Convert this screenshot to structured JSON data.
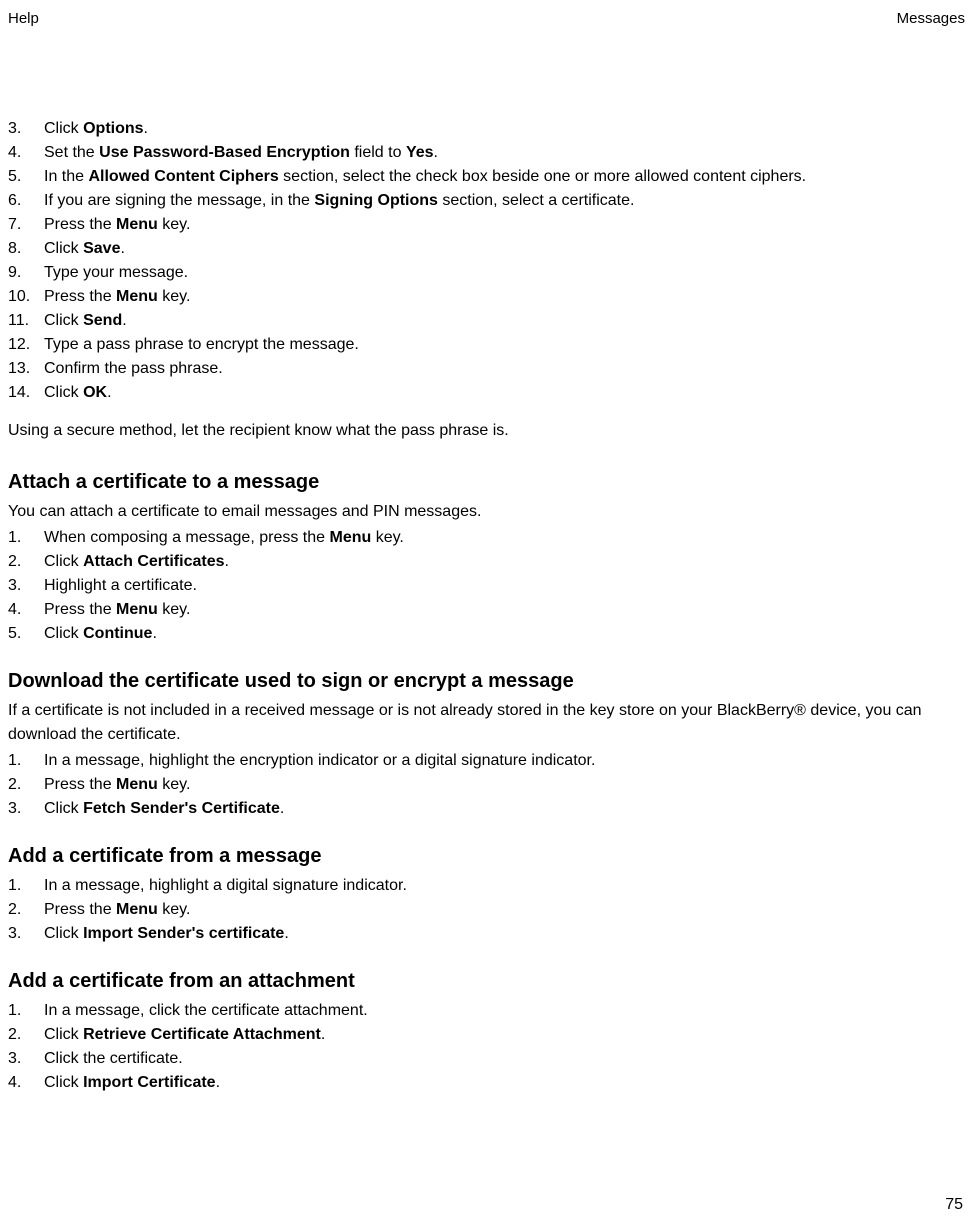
{
  "header": {
    "left": "Help",
    "right": "Messages"
  },
  "section1": {
    "steps": [
      {
        "num": "3.",
        "parts": [
          "Click ",
          "Options",
          "."
        ]
      },
      {
        "num": "4.",
        "parts": [
          "Set the ",
          "Use Password-Based Encryption",
          " field to ",
          "Yes",
          "."
        ]
      },
      {
        "num": "5.",
        "parts": [
          "In the ",
          "Allowed Content Ciphers",
          " section, select the check box beside one or more allowed content ciphers."
        ]
      },
      {
        "num": "6.",
        "parts": [
          "If you are signing the message, in the ",
          "Signing Options",
          " section, select a certificate."
        ]
      },
      {
        "num": "7.",
        "parts": [
          "Press the ",
          "Menu",
          " key."
        ]
      },
      {
        "num": "8.",
        "parts": [
          "Click ",
          "Save",
          "."
        ]
      },
      {
        "num": "9.",
        "parts": [
          "Type your message."
        ]
      },
      {
        "num": "10.",
        "parts": [
          "Press the ",
          "Menu",
          " key."
        ]
      },
      {
        "num": "11.",
        "parts": [
          "Click ",
          "Send",
          "."
        ]
      },
      {
        "num": "12.",
        "parts": [
          "Type a pass phrase to encrypt the message."
        ]
      },
      {
        "num": "13.",
        "parts": [
          "Confirm the pass phrase."
        ]
      },
      {
        "num": "14.",
        "parts": [
          "Click ",
          "OK",
          "."
        ]
      }
    ],
    "closing": "Using a secure method, let the recipient know what the pass phrase is."
  },
  "section2": {
    "title": "Attach a certificate to a message",
    "desc": "You can attach a certificate to email messages and PIN messages.",
    "steps": [
      {
        "num": "1.",
        "parts": [
          "When composing a message, press the ",
          "Menu",
          " key."
        ]
      },
      {
        "num": "2.",
        "parts": [
          "Click ",
          "Attach Certificates",
          "."
        ]
      },
      {
        "num": "3.",
        "parts": [
          "Highlight a certificate."
        ]
      },
      {
        "num": "4.",
        "parts": [
          "Press the ",
          "Menu",
          " key."
        ]
      },
      {
        "num": "5.",
        "parts": [
          "Click ",
          "Continue",
          "."
        ]
      }
    ]
  },
  "section3": {
    "title": "Download the certificate used to sign or encrypt a message",
    "desc": "If a certificate is not included in a received message or is not already stored in the key store on your BlackBerry® device, you can download the certificate.",
    "steps": [
      {
        "num": "1.",
        "parts": [
          "In a message, highlight the encryption indicator or a digital signature indicator."
        ]
      },
      {
        "num": "2.",
        "parts": [
          "Press the ",
          "Menu",
          " key."
        ]
      },
      {
        "num": "3.",
        "parts": [
          "Click ",
          "Fetch Sender's Certificate",
          "."
        ]
      }
    ]
  },
  "section4": {
    "title": "Add a certificate from a message",
    "steps": [
      {
        "num": "1.",
        "parts": [
          "In a message, highlight a digital signature indicator."
        ]
      },
      {
        "num": "2.",
        "parts": [
          "Press the ",
          "Menu",
          " key."
        ]
      },
      {
        "num": "3.",
        "parts": [
          "Click ",
          "Import Sender's certificate",
          "."
        ]
      }
    ]
  },
  "section5": {
    "title": "Add a certificate from an attachment",
    "steps": [
      {
        "num": "1.",
        "parts": [
          "In a message, click the certificate attachment."
        ]
      },
      {
        "num": "2.",
        "parts": [
          "Click ",
          "Retrieve Certificate Attachment",
          "."
        ]
      },
      {
        "num": "3.",
        "parts": [
          "Click the certificate."
        ]
      },
      {
        "num": "4.",
        "parts": [
          "Click ",
          "Import Certificate",
          "."
        ]
      }
    ]
  },
  "pageNumber": "75"
}
